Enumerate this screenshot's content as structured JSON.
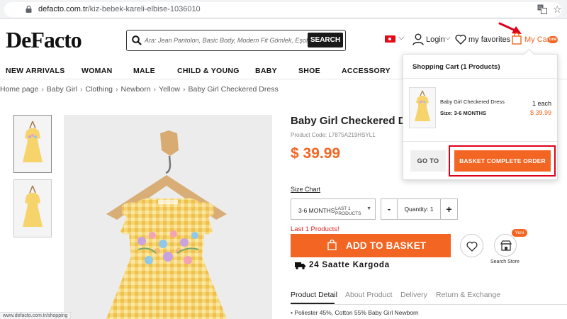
{
  "browser": {
    "url_host": "defacto.com.tr",
    "url_path": "/kiz-bebek-kareli-elbise-1036010"
  },
  "header": {
    "logo": "DeFacto",
    "search_placeholder": "Ara: Jean Pantolon, Basic Body, Modern Fit Gömlek, Eşofman",
    "search_button": "SEARCH",
    "login": "Login",
    "favorites": "my favorites",
    "cart": "My Cart",
    "cart_badge": "one"
  },
  "nav": {
    "items": [
      "NEW ARRIVALS",
      "WOMAN",
      "MALE",
      "CHILD & YOUNG",
      "BABY",
      "SHOE",
      "ACCESSORY"
    ]
  },
  "breadcrumb": [
    "Home page",
    "Baby Girl",
    "Clothing",
    "Newborn",
    "Yellow",
    "Baby Girl Checkered Dress"
  ],
  "product": {
    "title": "Baby Girl Checkered Dres",
    "code": "Product Code: L7875A219HSYL1",
    "price": "$ 39.99",
    "size_chart": "Size Chart",
    "size_value": "3-6 MONTHS",
    "size_stock": "LAST 1 PRODUCTS",
    "qty_minus": "-",
    "qty_label": "Quantity: 1",
    "qty_plus": "+",
    "stock_warning": "Last 1 Products!",
    "add_to_basket": "ADD TO BASKET",
    "new_badge": "Yeni",
    "search_store": "Search Store",
    "cargo": "24 Saatte Kargoda",
    "tabs": [
      "Product Detail",
      "About Product",
      "Delivery",
      "Return & Exchange"
    ],
    "detail": "•  Poliester 45%, Cotton 55% Baby Girl Newborn"
  },
  "cart_panel": {
    "header": "Shopping Cart (1 Products)",
    "item_name": "Baby Girl Checkered Dress",
    "item_size": "Size: 3-6 MONTHS",
    "item_qty": "1 each",
    "item_price": "$ 39.99",
    "goto": "GO TO",
    "complete": "BASKET COMPLETE ORDER"
  },
  "status_bar": "www.defacto.com.tr/shopping",
  "colors": {
    "accent": "#f26522",
    "highlight_frame": "#e0001b",
    "warning": "#e02020",
    "dress_yellow": "#f6d36b"
  }
}
